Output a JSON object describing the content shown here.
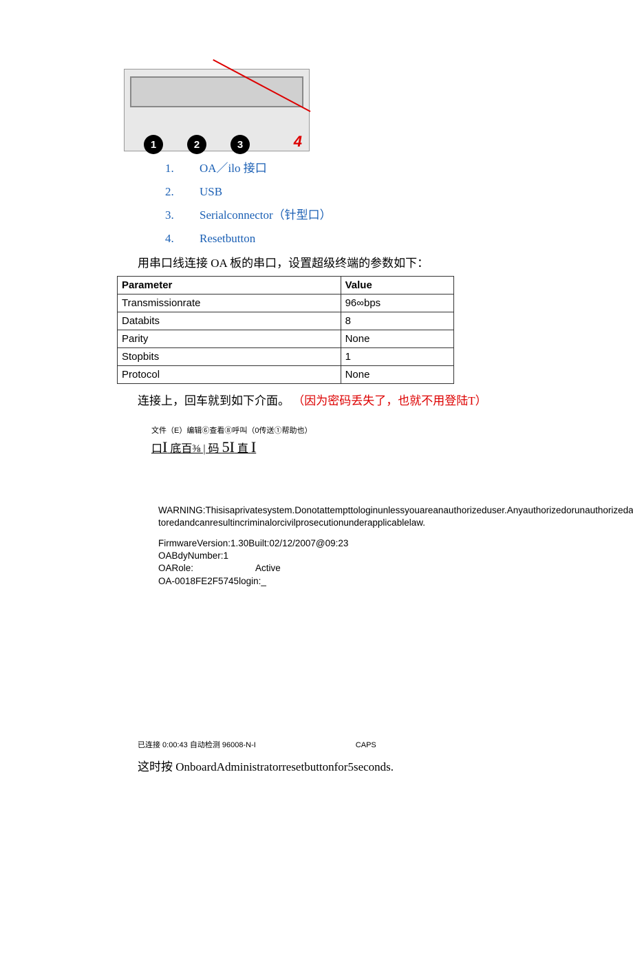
{
  "image_labels": {
    "c1": "1",
    "c2": "2",
    "c3": "3",
    "red4": "4"
  },
  "ports": [
    {
      "num": "1.",
      "label": "OA／ilo 接口"
    },
    {
      "num": "2.",
      "label": "USB"
    },
    {
      "num": "3.",
      "label": "Serialconnector（针型口）"
    },
    {
      "num": "4.",
      "label": "Resetbutton"
    }
  ],
  "desc1": "用串口线连接 OA 板的串口，设置超级终端的参数如下：",
  "param_table": {
    "headers": [
      "Parameter",
      "Value"
    ],
    "rows": [
      [
        "Transmissionrate",
        "96∞bps"
      ],
      [
        "Databits",
        "8"
      ],
      [
        "Parity",
        "None"
      ],
      [
        "Stopbits",
        "1"
      ],
      [
        "Protocol",
        "None"
      ]
    ]
  },
  "desc2": {
    "part1": "连接上，回车就到如下介面。",
    "part2_red": "（因为密码丢失了，也就不用登陆T）"
  },
  "menu_line": "文件（E）编辑⑥查看⑧呼叫（0传送①帮助也）",
  "toolbar_line": {
    "a": "口",
    "b": "I",
    "c": " 底百⅜ | 码 ",
    "d": "5I",
    "e": " 直 ",
    "f": "I"
  },
  "terminal": {
    "warn1": "WARNING:Thisisaprivatesystem.Donotattempttologinunlessyouareanauthorizeduser.Anyauthorizedorunauthorizedaccessandusemaμbemoni-",
    "warn2": "toredandcanresultincriminalorcivilprosecutionunderapplicablelaw.",
    "fw": "FirmwareVersion:1.30Built:02/12/2007@09:23",
    "bay": "OABdyNumber:1",
    "role_label": "OARole:",
    "role_value": "Active",
    "login": "OA-0018FE2F5745login:_"
  },
  "status": {
    "conn": "已连接 0:00:43 自动检测 96008-N-I",
    "caps": "CAPS"
  },
  "desc3": "这时按 OnboardAdministratorresetbuttonfor5seconds."
}
